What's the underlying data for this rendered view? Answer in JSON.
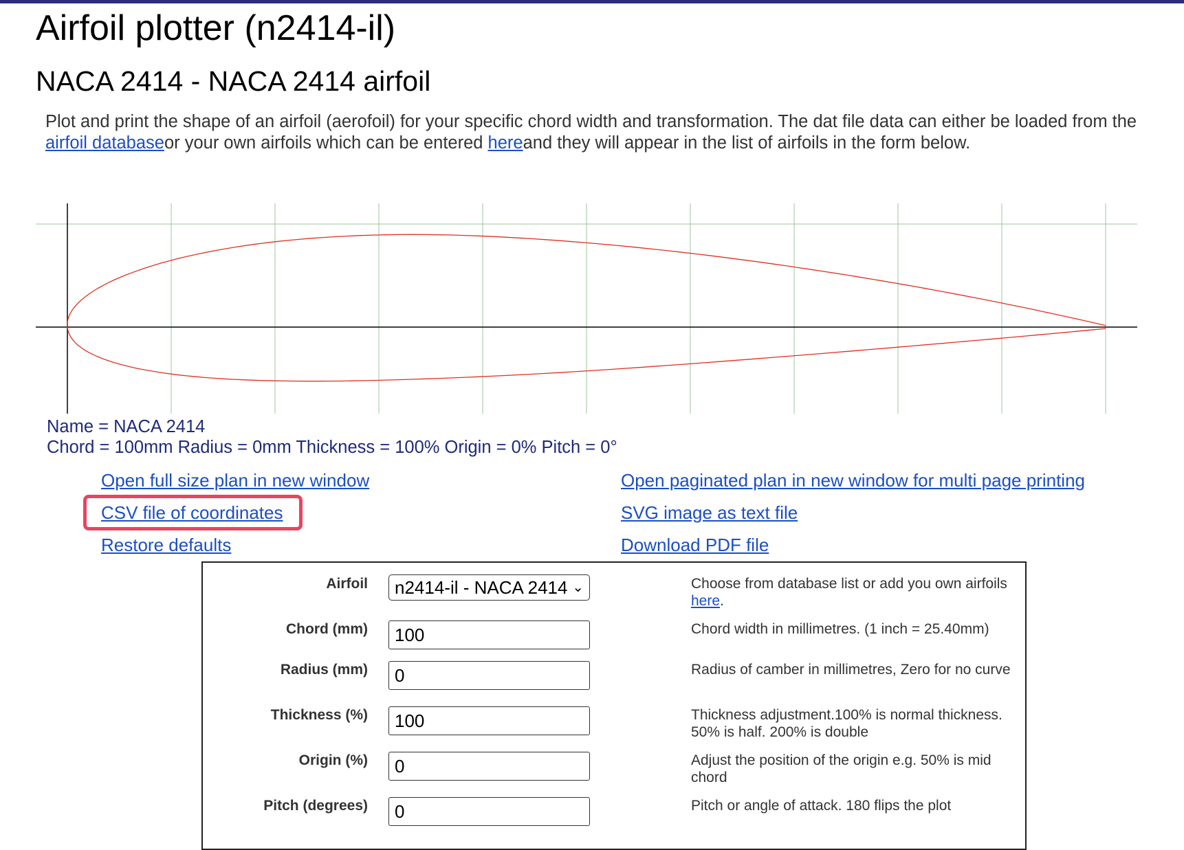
{
  "page": {
    "title": "Airfoil plotter (n2414-il)",
    "subtitle": "NACA 2414 - NACA 2414 airfoil",
    "intro": {
      "part1": "Plot and print the shape of an airfoil (aerofoil) for your specific chord width and transformation. The dat file data can either be loaded from the ",
      "link1": "airfoil database",
      "part2": "or your own airfoils which can be entered ",
      "link2": "here",
      "part3": "and they will appear in the list of airfoils in the form below."
    }
  },
  "plot": {
    "colors": {
      "grid": "#9cc49c",
      "axes": "#000000",
      "profile": "#e03020"
    }
  },
  "info": {
    "name_line": "Name = NACA 2414",
    "params_line": "Chord = 100mm Radius = 0mm Thickness = 100% Origin = 0% Pitch = 0°"
  },
  "links": {
    "open_full": "Open full size plan in new window",
    "csv": "CSV file of coordinates",
    "restore": "Restore defaults",
    "open_paginated": "Open paginated plan in new window for multi page printing",
    "svg": "SVG image as text file",
    "pdf": "Download PDF file"
  },
  "form": {
    "airfoil": {
      "label": "Airfoil",
      "value": "n2414-il - NACA 2414",
      "help": "Choose from database list or add you own airfoils ",
      "help_link": "here",
      "help_end": "."
    },
    "chord": {
      "label": "Chord (mm)",
      "value": "100",
      "help": "Chord width in millimetres. (1 inch = 25.40mm)"
    },
    "radius": {
      "label": "Radius (mm)",
      "value": "0",
      "help": "Radius of camber in millimetres, Zero for no curve"
    },
    "thickness": {
      "label": "Thickness (%)",
      "value": "100",
      "help": "Thickness adjustment.100% is normal thickness. 50% is half. 200% is double"
    },
    "origin": {
      "label": "Origin (%)",
      "value": "0",
      "help": "Adjust the position of the origin e.g. 50% is mid chord"
    },
    "pitch": {
      "label": "Pitch (degrees)",
      "value": "0",
      "help": "Pitch or angle of attack. 180 flips the plot"
    }
  }
}
